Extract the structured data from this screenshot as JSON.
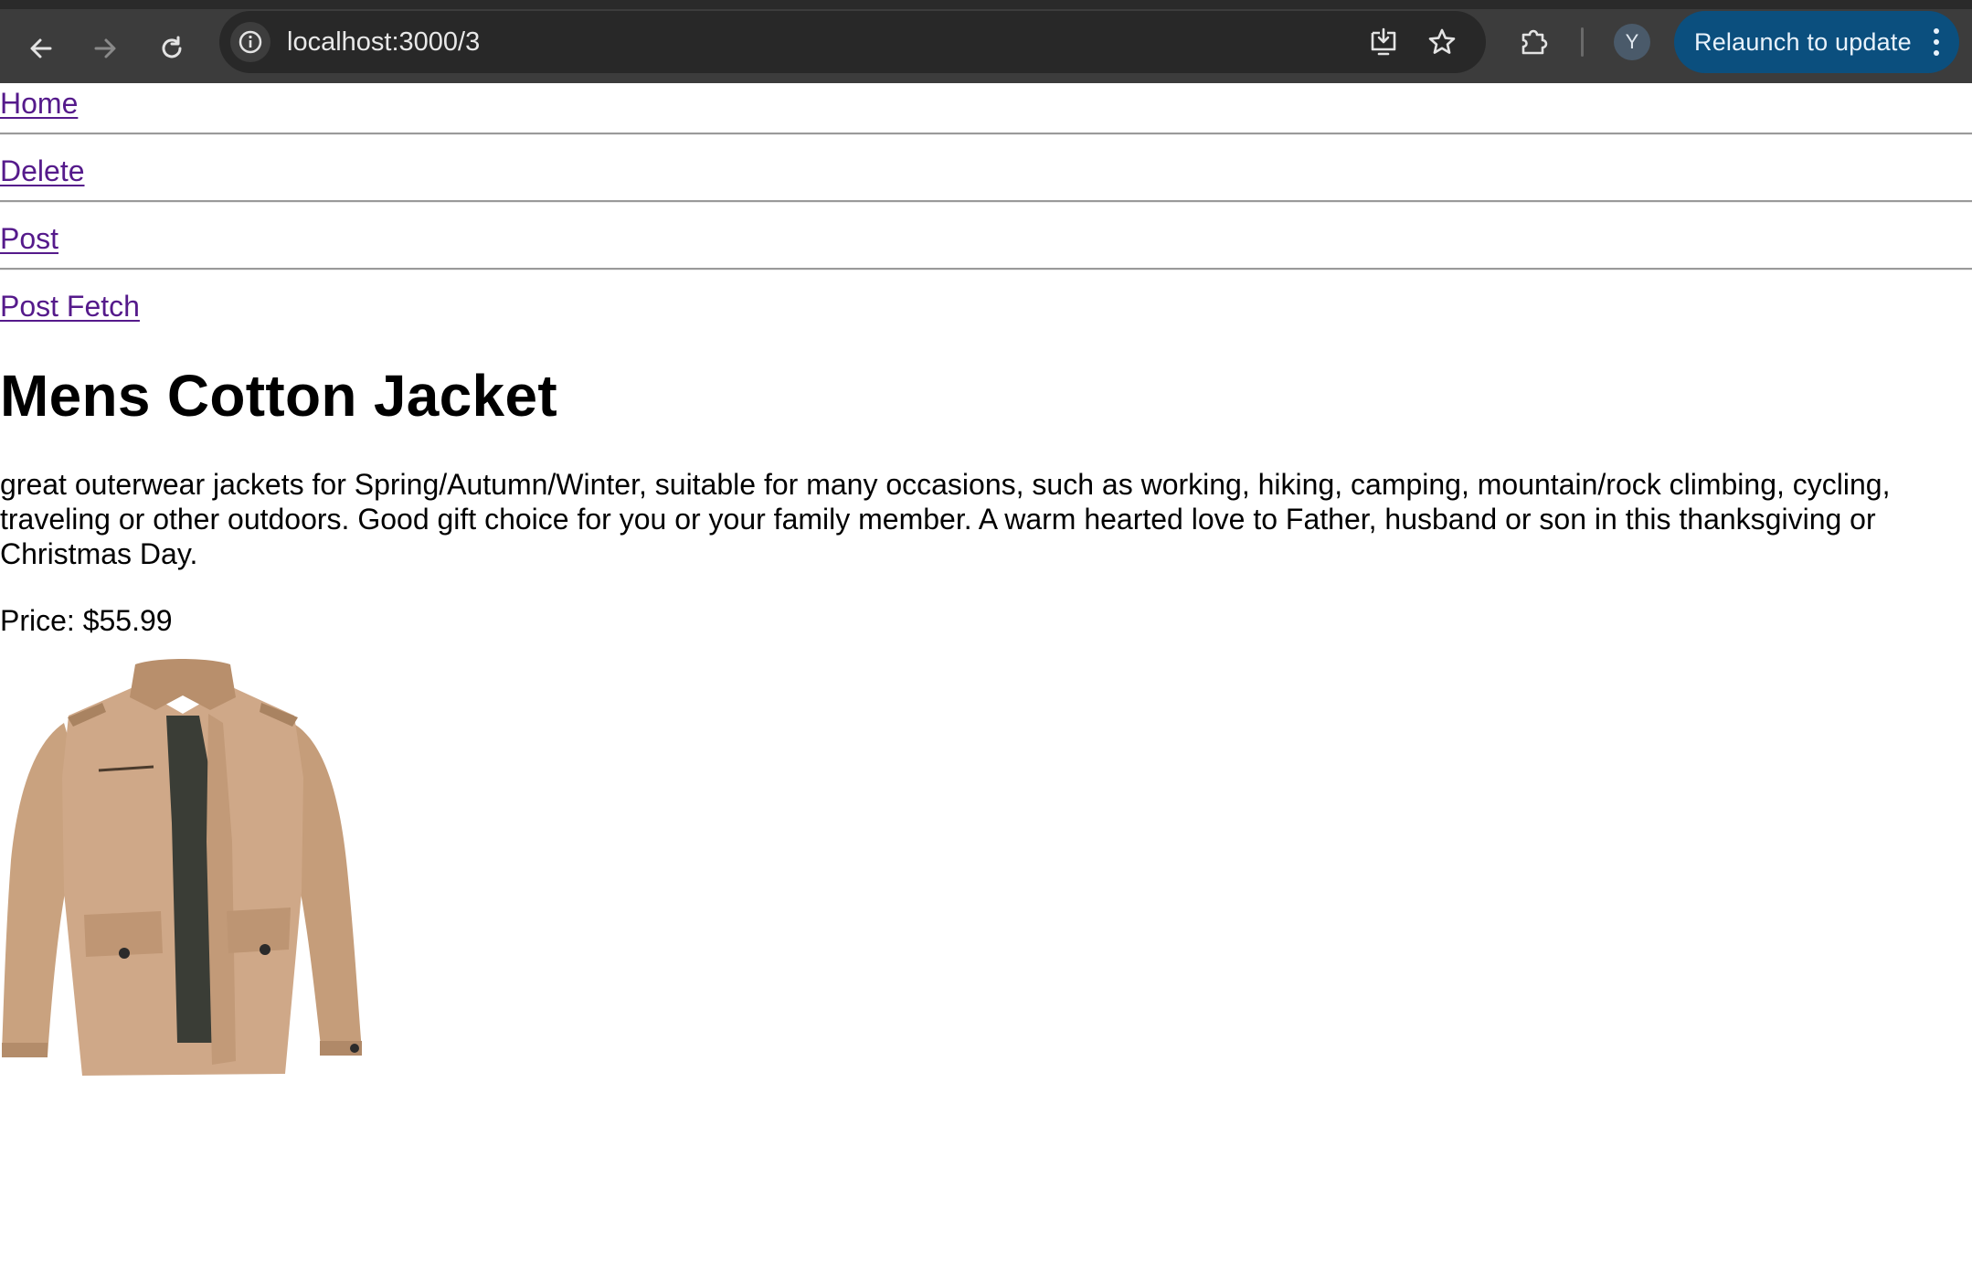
{
  "browser": {
    "url": "localhost:3000/3",
    "avatar_letter": "Y",
    "relaunch_label": "Relaunch to update",
    "accent_color": "#0b4f7e",
    "icons": [
      "back-arrow-icon",
      "forward-arrow-icon",
      "reload-icon",
      "site-info-icon",
      "install-app-icon",
      "bookmark-star-icon",
      "extensions-puzzle-icon",
      "kebab-menu-icon"
    ]
  },
  "nav": {
    "links": [
      "Home",
      "Delete",
      "Post",
      "Post Fetch"
    ]
  },
  "product": {
    "title": "Mens Cotton Jacket",
    "description": "great outerwear jackets for Spring/Autumn/Winter, suitable for many occasions, such as working, hiking, camping, mountain/rock climbing, cycling, traveling or other outdoors. Good gift choice for you or your family member. A warm hearted love to Father, husband or son in this thanksgiving or Christmas Day.",
    "price_text": "Price: $55.99",
    "image_subject": "tan cotton jacket",
    "image_color": "#cfa888"
  }
}
